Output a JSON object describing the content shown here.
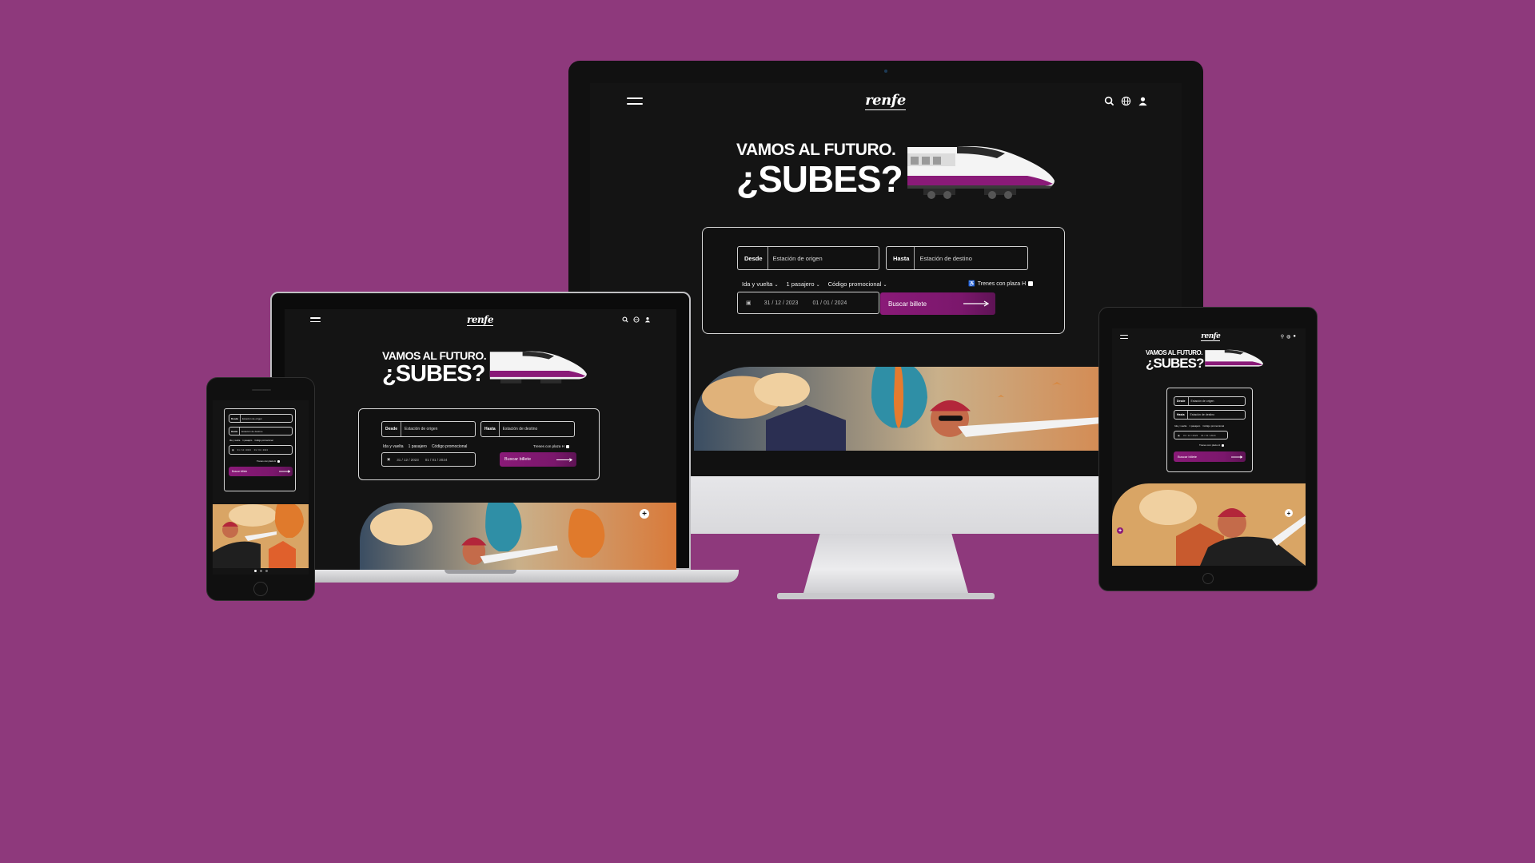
{
  "site": {
    "logo": "renfe",
    "hero": {
      "line1": "VAMOS AL FUTURO.",
      "line2": "¿SUBES?"
    },
    "search": {
      "from_label": "Desde",
      "from_placeholder": "Estación de origen",
      "to_label": "Hasta",
      "to_placeholder": "Estación de destino",
      "trip_type": "Ida y vuelta",
      "passengers": "1 pasajero",
      "promo": "Código promocional",
      "accessible": "Trenes con plaza H",
      "date_out": "31 / 12 / 2023",
      "date_return": "01 / 01 / 2024",
      "button": "Buscar billete"
    },
    "icons": {
      "menu": "hamburger-icon",
      "search": "search-icon",
      "language": "globe-icon",
      "account": "user-icon"
    }
  },
  "colors": {
    "background": "#8e397c",
    "accent": "#8a1a78",
    "screen": "#141414"
  }
}
